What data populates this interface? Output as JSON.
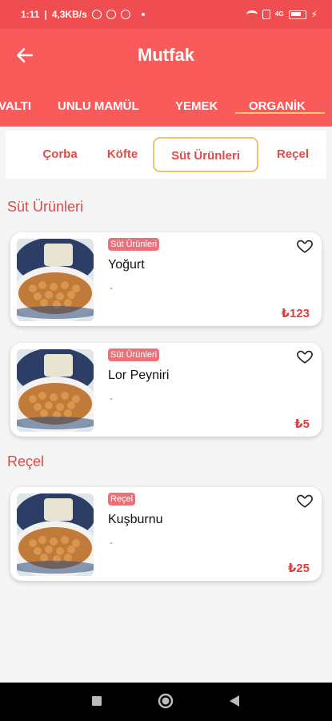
{
  "status_bar": {
    "time": "1:11",
    "speed": "4,3KB/s",
    "signal_text": "4G"
  },
  "app_bar": {
    "title": "Mutfak"
  },
  "tabs": [
    "VALTI",
    "UNLU MAMÜL",
    "YEMEK",
    "ORGANİK"
  ],
  "active_tab": "ORGANİK",
  "sub_tabs": [
    "Çorba",
    "Köfte",
    "Süt Ürünleri",
    "Reçel"
  ],
  "active_sub_tab": "Süt Ürünleri",
  "sections": [
    {
      "title": "Süt Ürünleri",
      "products": [
        {
          "category": "Süt Ürünleri",
          "name": "Yoğurt",
          "description": "-",
          "price": "₺123"
        },
        {
          "category": "Süt Ürünleri",
          "name": "Lor Peyniri",
          "description": "-",
          "price": "₺5"
        }
      ]
    },
    {
      "title": "Reçel",
      "products": [
        {
          "category": "Reçel",
          "name": "Kuşburnu",
          "description": "-",
          "price": "₺25"
        }
      ]
    }
  ],
  "colors": {
    "primary": "#f95a5a",
    "status_bar": "#f04d50",
    "accent": "#e9c472",
    "badge": "#e9727a",
    "price": "#e23d3d"
  },
  "icons": {
    "back": "arrow-left-icon",
    "favorite": "heart-outline-icon",
    "nav_recents": "square-icon",
    "nav_home": "circle-icon",
    "nav_back": "triangle-icon"
  }
}
